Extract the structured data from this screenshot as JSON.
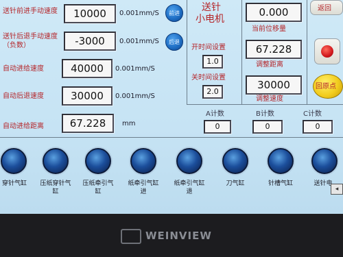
{
  "row1": {
    "label": "送针前进手动速度",
    "value": "10000",
    "unit": "0.001mm/S",
    "button": "前进"
  },
  "row2": {
    "label": "送针后退手动速度（负数）",
    "value": "-3000",
    "unit": "0.001mm/S",
    "button": "后退"
  },
  "row3": {
    "label": "自动进给速度",
    "value": "40000",
    "unit": "0.001mm/S"
  },
  "row4": {
    "label": "自动后退速度",
    "value": "30000",
    "unit": "0.001mm/S"
  },
  "row5": {
    "label": "自动进给距离",
    "value": "67.228",
    "unit": "mm"
  },
  "motor_title_1": "送针",
  "motor_title_2": "小电机",
  "open_time": {
    "label": "开时间设置",
    "value": "1.0"
  },
  "close_time": {
    "label": "关时间设置",
    "value": "2.0"
  },
  "current_position": {
    "value": "0.000",
    "label": "当前位移量"
  },
  "adjust_distance": {
    "value": "67.228",
    "label": "调整距离"
  },
  "adjust_speed": {
    "value": "30000",
    "label": "调整速度"
  },
  "top_right_button": "返回",
  "home_button": "回原点",
  "counters": [
    {
      "label": "A计数",
      "value": "0"
    },
    {
      "label": "B计数",
      "value": "0"
    },
    {
      "label": "C计数",
      "value": "0"
    }
  ],
  "cylinders": [
    {
      "label": "穿针气缸"
    },
    {
      "label": "压纸穿针气缸"
    },
    {
      "label": "压纸牵引气缸"
    },
    {
      "label": "纸牵引气缸进"
    },
    {
      "label": "纸牵引气缸退"
    },
    {
      "label": "刀气缸"
    },
    {
      "label": "针槽气缸"
    },
    {
      "label": "送针电"
    }
  ],
  "bezel_brand": "WEINVIEW",
  "colors": {
    "screen_bg": "#c6e3f4",
    "label_red": "#b5262a",
    "button_blue": "#1f6fc5",
    "bezel": "#1c1c1f"
  }
}
